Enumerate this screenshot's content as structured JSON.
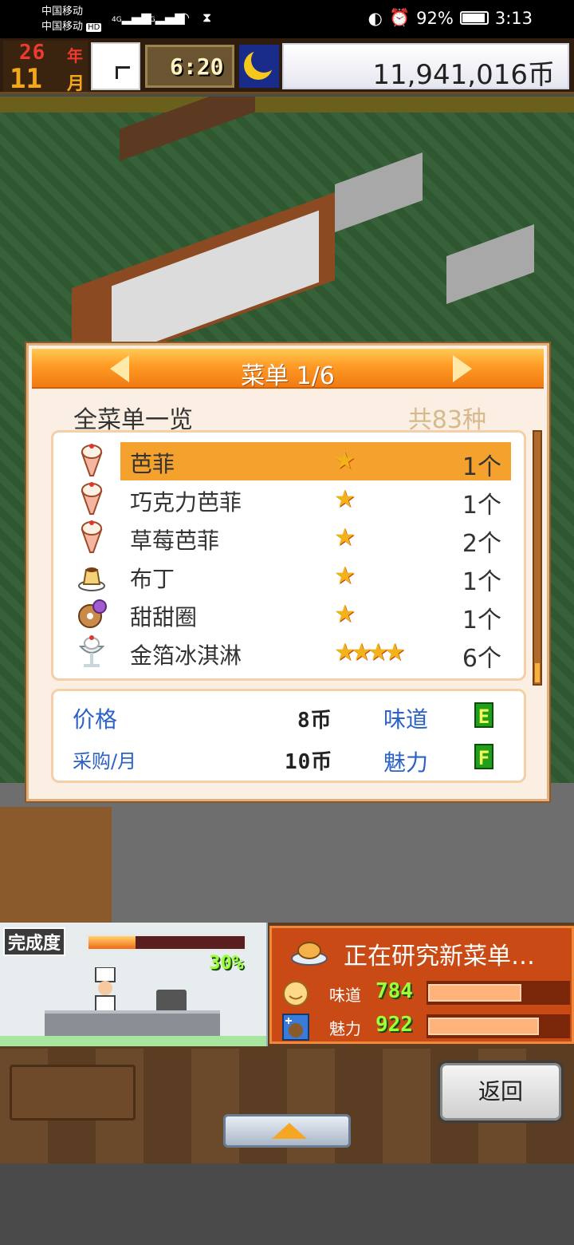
{
  "status_bar": {
    "carrier1": "中国移动",
    "carrier2": "中国移动",
    "hd": "HD",
    "net1": "4G",
    "net2": "4G",
    "battery_pct": "92%",
    "time": "3:13"
  },
  "hud": {
    "year": "26",
    "year_label": "年",
    "month": "11",
    "month_label": "月",
    "game_time": "6:20",
    "money": "11,941,016币"
  },
  "menu_dialog": {
    "title": "菜单 1/6",
    "subtitle": "全菜单一览",
    "total": "共83种",
    "items": [
      {
        "name": "芭菲",
        "stars": "★",
        "count": "1个",
        "icon": "parfait-icon",
        "selected": true
      },
      {
        "name": "巧克力芭菲",
        "stars": "★",
        "count": "1个",
        "icon": "parfait-icon",
        "selected": false
      },
      {
        "name": "草莓芭菲",
        "stars": "★",
        "count": "2个",
        "icon": "parfait-icon",
        "selected": false
      },
      {
        "name": "布丁",
        "stars": "★",
        "count": "1个",
        "icon": "pudding-icon",
        "selected": false
      },
      {
        "name": "甜甜圈",
        "stars": "★",
        "count": "1个",
        "icon": "donut-icon",
        "selected": false
      },
      {
        "name": "金箔冰淇淋",
        "stars": "★★★★",
        "count": "6个",
        "icon": "sundae-icon",
        "selected": false
      }
    ],
    "info": {
      "price_label": "价格",
      "price_value": "8币",
      "taste_label": "味道",
      "taste_grade": "E",
      "purchase_label": "采购/月",
      "purchase_value": "10币",
      "charm_label": "魅力",
      "charm_grade": "F"
    }
  },
  "kitchen": {
    "label": "完成度",
    "progress": 0.3,
    "progress_text": "30%"
  },
  "research": {
    "title": "正在研究新菜单…",
    "taste_label": "味道",
    "taste_value": "784",
    "taste_level": 0.65,
    "charm_label": "魅力",
    "charm_value": "922",
    "charm_level": 0.77
  },
  "buttons": {
    "back": "返回"
  },
  "colors": {
    "dialog_header": "#f07b12",
    "selected_row": "#f5a12d",
    "label_blue": "#2b62c7",
    "grade_green": "#1f9f1a"
  }
}
